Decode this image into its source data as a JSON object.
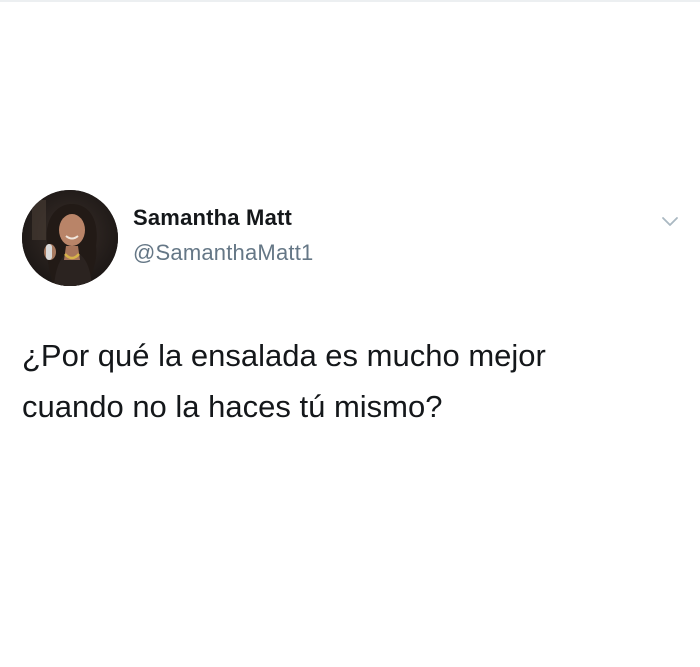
{
  "tweet": {
    "author": {
      "name": "Samantha Matt",
      "handle": "@SamanthaMatt1",
      "avatar_icon": "profile-photo"
    },
    "menu_icon": "chevron-down-icon",
    "text_lines": [
      "¿Por qué la ensalada es mucho mejor",
      "cuando no la haces tú mismo?"
    ]
  },
  "colors": {
    "background": "#ffffff",
    "name_text": "#14171a",
    "handle_text": "#657786",
    "caret": "#aab8c2"
  }
}
